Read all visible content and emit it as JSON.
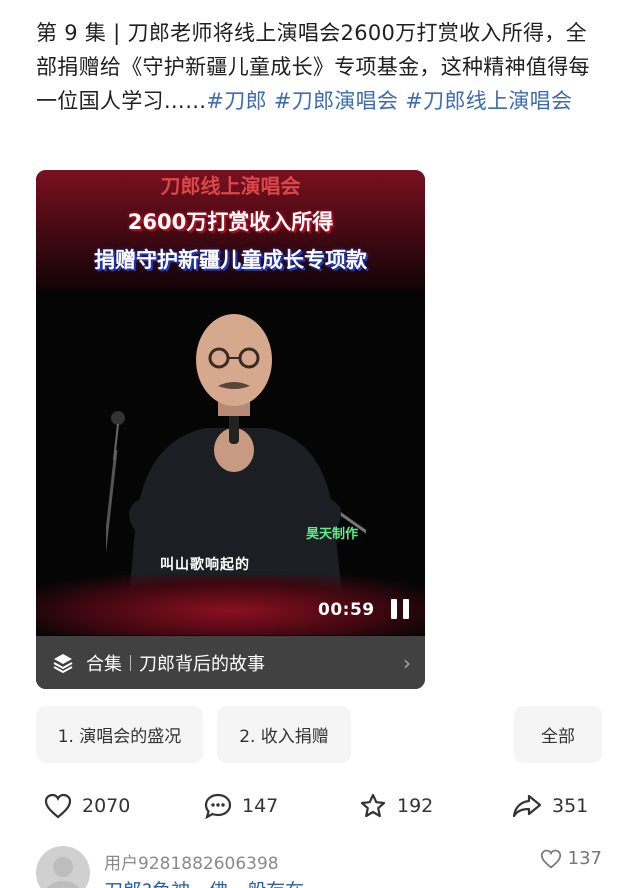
{
  "post": {
    "text_prefix": "第 9 集 | 刀郎老师将线上演唱会2600万打赏收入所得，全部捐赠给《守护新疆儿童成长》专项基金，这种精神值得每一位国人学习……",
    "tags": [
      "#刀郎",
      "#刀郎演唱会",
      "#刀郎线上演唱会"
    ]
  },
  "video": {
    "caption_1": "刀郎线上演唱会",
    "caption_2": "2600万打赏收入所得",
    "caption_3": "捐赠守护新疆儿童成长专项款",
    "watermark": "昊天制作",
    "lyric": "叫山歌响起的",
    "time": "00:59",
    "collection_label": "合集",
    "collection_title": "刀郎背后的故事"
  },
  "chips": [
    {
      "label": "1. 演唱会的盛况"
    },
    {
      "label": "2. 收入捐赠"
    },
    {
      "label": "全部"
    }
  ],
  "actions": {
    "like_count": "2070",
    "comment_count": "147",
    "favorite_count": "192",
    "share_count": "351"
  },
  "comment": {
    "username": "用户9281882606398",
    "text": "刀郎?鱼神，佛一般存在",
    "likes": "137"
  },
  "colors": {
    "tag": "#3d6bb5",
    "chip_bg": "#f5f5f5",
    "collection_bar": "#464646"
  }
}
